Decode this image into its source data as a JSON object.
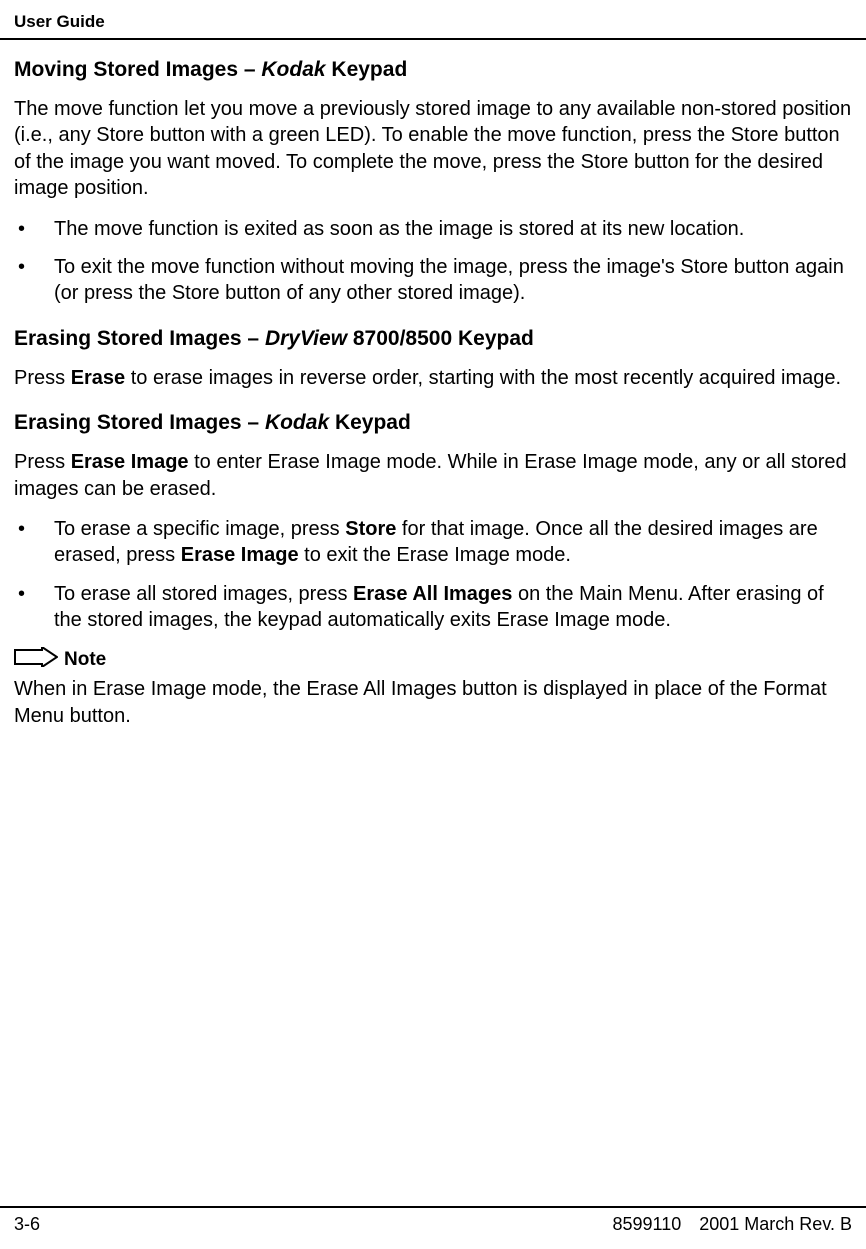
{
  "header": {
    "title": "User Guide"
  },
  "sections": {
    "s1": {
      "title_prefix": "Moving Stored Images – ",
      "title_italic": "Kodak",
      "title_suffix": " Keypad",
      "para": "The move function let you move a previously stored image to any available non-stored position (i.e., any Store button with a green LED). To enable the move function, press the Store button of the image you want moved. To complete the move, press the Store button for the desired image position.",
      "bullets": {
        "b1": "The move function is exited as soon as the image is stored at its new location.",
        "b2": "To exit the move function without moving the image, press the image's Store button again (or press the Store button of any other stored image)."
      }
    },
    "s2": {
      "title_prefix": "Erasing Stored Images – ",
      "title_italic": "DryView",
      "title_suffix": " 8700/8500 Keypad",
      "para_pre": "Press ",
      "para_bold": "Erase",
      "para_post": " to erase images in reverse order, starting with the most recently acquired image."
    },
    "s3": {
      "title_prefix": "Erasing Stored Images – ",
      "title_italic": "Kodak",
      "title_suffix": " Keypad",
      "para_pre": "Press ",
      "para_bold": "Erase Image",
      "para_post": " to enter Erase Image mode. While in Erase Image mode, any or all stored images can be erased.",
      "bullets": {
        "b1_pre": "To erase a specific image, press ",
        "b1_bold1": "Store",
        "b1_mid": " for that image. Once all the desired images are erased, press ",
        "b1_bold2": "Erase Image",
        "b1_post": " to exit the Erase Image mode.",
        "b2_pre": "To erase all stored images, press ",
        "b2_bold": "Erase All Images",
        "b2_post": " on the Main Menu. After erasing of the stored images, the keypad automatically exits Erase Image mode."
      }
    },
    "note": {
      "label": "Note",
      "text": "When in Erase Image mode, the Erase All Images button is displayed in place of the Format Menu button."
    }
  },
  "footer": {
    "page": "3-6",
    "docnum": "8599110",
    "rev": "2001 March Rev. B"
  }
}
